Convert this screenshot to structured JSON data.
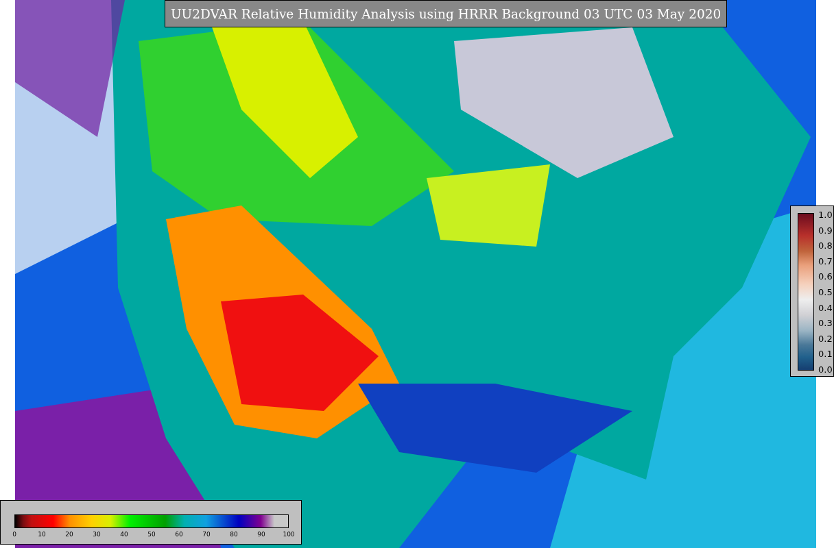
{
  "title": "UU2DVAR Relative Humidity Analysis using HRRR Background 03 UTC 03 May 2020",
  "humidity_colorbar": {
    "ticks": [
      "0",
      "10",
      "20",
      "30",
      "40",
      "50",
      "60",
      "70",
      "80",
      "90",
      "100"
    ]
  },
  "observation_colorbar": {
    "ticks": [
      "1.0",
      "0.9",
      "0.8",
      "0.7",
      "0.6",
      "0.5",
      "0.4",
      "0.3",
      "0.2",
      "0.1",
      "0.0"
    ]
  }
}
